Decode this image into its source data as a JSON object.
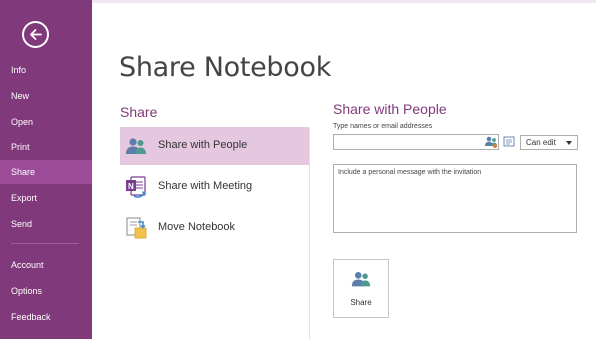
{
  "sidebar": {
    "back_label": "Back",
    "items": [
      {
        "label": "Info"
      },
      {
        "label": "New"
      },
      {
        "label": "Open"
      },
      {
        "label": "Print"
      },
      {
        "label": "Share",
        "selected": true
      },
      {
        "label": "Export"
      },
      {
        "label": "Send"
      },
      {
        "label": "Account"
      },
      {
        "label": "Options"
      },
      {
        "label": "Feedback"
      }
    ]
  },
  "page": {
    "title": "Share Notebook",
    "section_title": "Share",
    "options": [
      {
        "label": "Share with People",
        "icon": "people-icon",
        "selected": true
      },
      {
        "label": "Share with Meeting",
        "icon": "onenote-meeting-icon",
        "selected": false
      },
      {
        "label": "Move Notebook",
        "icon": "move-notebook-icon",
        "selected": false
      }
    ]
  },
  "panel": {
    "title": "Share with People",
    "names_label": "Type names or email addresses",
    "names_value": "",
    "permission": "Can edit",
    "message_placeholder": "Include a personal message with the invitation",
    "share_button_label": "Share"
  },
  "colors": {
    "sidebar": "#80397b",
    "sidebar_selected": "#9b4b97",
    "accent": "#80397b",
    "option_selected": "#e6c7e0"
  }
}
